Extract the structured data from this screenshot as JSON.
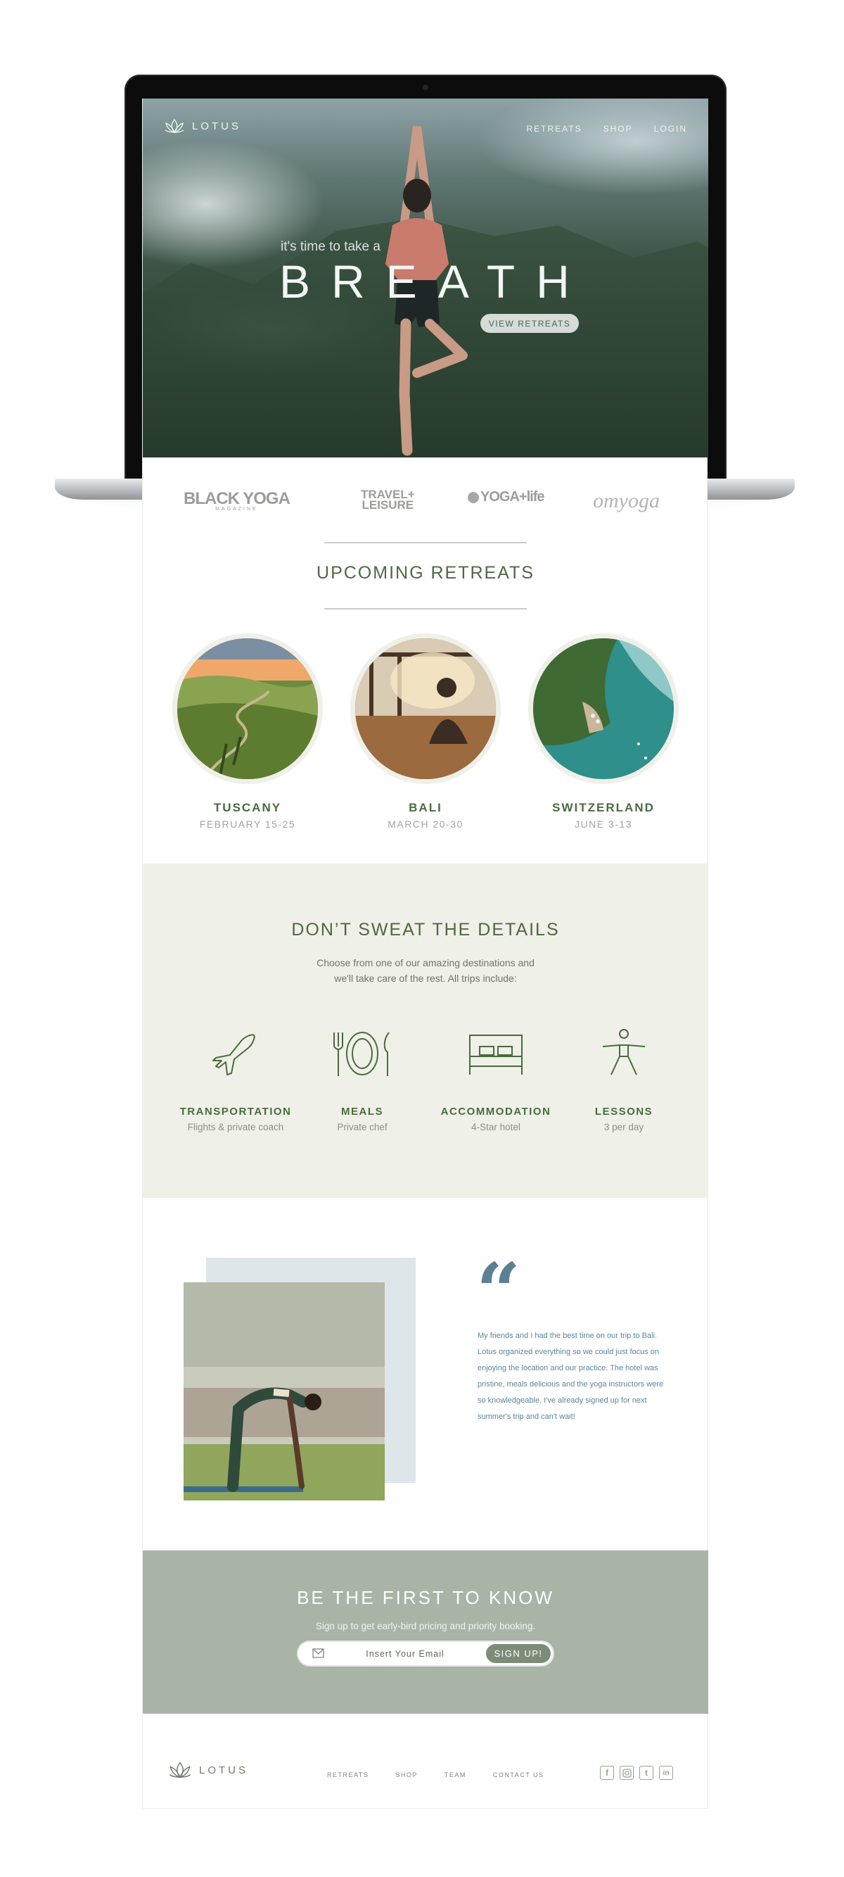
{
  "nav": {
    "logo_text": "LOTUS",
    "links": [
      "RETREATS",
      "SHOP",
      "LOGIN"
    ]
  },
  "hero": {
    "pretitle": "it's time to take a",
    "title": "BREATH",
    "cta_label": "VIEW RETREATS"
  },
  "press": [
    {
      "name": "BLACK YOGA",
      "sub": "MAGAZINE"
    },
    {
      "name": "TRAVEL+",
      "sub": "LEISURE"
    },
    {
      "name": "YOGA+life"
    },
    {
      "name": "omyoga"
    }
  ],
  "retreats": {
    "title": "UPCOMING RETREATS",
    "items": [
      {
        "name": "TUSCANY",
        "dates": "FEBRUARY 15-25"
      },
      {
        "name": "BALI",
        "dates": "MARCH 20-30"
      },
      {
        "name": "SWITZERLAND",
        "dates": "JUNE 3-13"
      }
    ]
  },
  "details": {
    "title": "DON’T SWEAT THE DETAILS",
    "subtitle_line1": "Choose from one of our amazing destinations and",
    "subtitle_line2": "we'll take care of the rest. All trips include:",
    "features": [
      {
        "icon": "airplane-icon",
        "title": "TRANSPORTATION",
        "sub": "Flights & private coach"
      },
      {
        "icon": "plate-cutlery-icon",
        "title": "MEALS",
        "sub": "Private chef"
      },
      {
        "icon": "bed-icon",
        "title": "ACCOMMODATION",
        "sub": "4-Star hotel"
      },
      {
        "icon": "yoga-pose-icon",
        "title": "LESSONS",
        "sub": "3 per day"
      }
    ]
  },
  "testimonial": {
    "quote_mark": "“",
    "lines": [
      "My friends and I had the best time on our trip to Bali.",
      "Lotus organized everything so we could just focus on",
      "enjoying the location and our practice. The hotel was",
      "pristine, meals delicious and the yoga instructors were",
      "so knowledgeable. I've already signed up for next",
      "summer's trip and can't wait!"
    ]
  },
  "signup": {
    "title": "BE THE FIRST TO KNOW",
    "subtitle": "Sign up to get early-bird pricing and priority booking.",
    "email_placeholder": "Insert Your Email",
    "button_label": "SIGN UP!"
  },
  "footer": {
    "logo_text": "LOTUS",
    "links": [
      "RETREATS",
      "SHOP",
      "TEAM",
      "CONTACT US"
    ],
    "social": [
      "f",
      "instagram",
      "t",
      "in"
    ]
  },
  "colors": {
    "accent_green": "#4b6a3f",
    "details_bg": "#eff0e8",
    "signup_bg": "#a9b4a7",
    "quote_blue": "#5a8193"
  }
}
